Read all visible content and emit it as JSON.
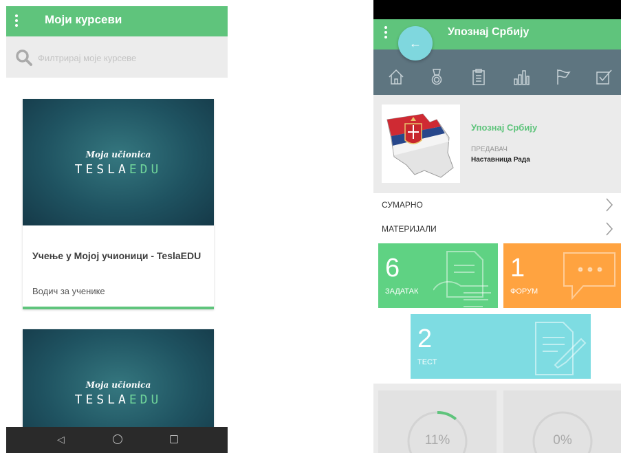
{
  "left_screen": {
    "app_bar": {
      "title": "Моји курсеви",
      "menu_icon": "more-vert-icon"
    },
    "search": {
      "placeholder": "Филтрирај моје курсеве",
      "icon": "search-icon"
    },
    "courses": [
      {
        "logo_script": "Moja učionica",
        "logo_brand": "TESLA",
        "logo_brand_suffix": "EDU",
        "title": "Учење у Мојој учионици - TeslaEDU",
        "subtitle": "Водич за ученике"
      },
      {
        "logo_script": "Moja učionica",
        "logo_brand": "TESLA",
        "logo_brand_suffix": "EDU"
      }
    ],
    "nav_bar": {
      "icons": [
        "back-triangle-icon",
        "home-circle-icon",
        "recents-square-icon"
      ]
    },
    "accent": "#5fc47c"
  },
  "right_screen": {
    "app_bar": {
      "title": "Упознај Србију",
      "back_arrow": "←",
      "menu_icon": "more-vert-icon"
    },
    "toolbar_icons": [
      "home-icon",
      "medal-icon",
      "clipboard-icon",
      "bar-chart-icon",
      "flag-icon",
      "checkbox-icon"
    ],
    "course": {
      "name": "Упознај Србију",
      "teacher_label": "ПРЕДАВАЧ",
      "teacher_name": "Наставница Рада",
      "image": "serbia-map-flag"
    },
    "rows": [
      {
        "label": "СУМАРНО"
      },
      {
        "label": "МАТЕРИЈАЛИ"
      }
    ],
    "tiles": [
      {
        "count": "6",
        "label": "ЗАДАТАК",
        "color": "#5fd283"
      },
      {
        "count": "1",
        "label": "ФОРУМ",
        "color": "#ffa340"
      },
      {
        "count": "2",
        "label": "ТЕСТ",
        "color": "#7edce2"
      }
    ],
    "gauges": [
      {
        "value": "11%",
        "fraction": 0.11
      },
      {
        "value": "0%",
        "fraction": 0
      }
    ],
    "colors": {
      "toolbar": "#5e7580",
      "accent": "#5fc47c",
      "fab": "#7fd7de"
    }
  }
}
